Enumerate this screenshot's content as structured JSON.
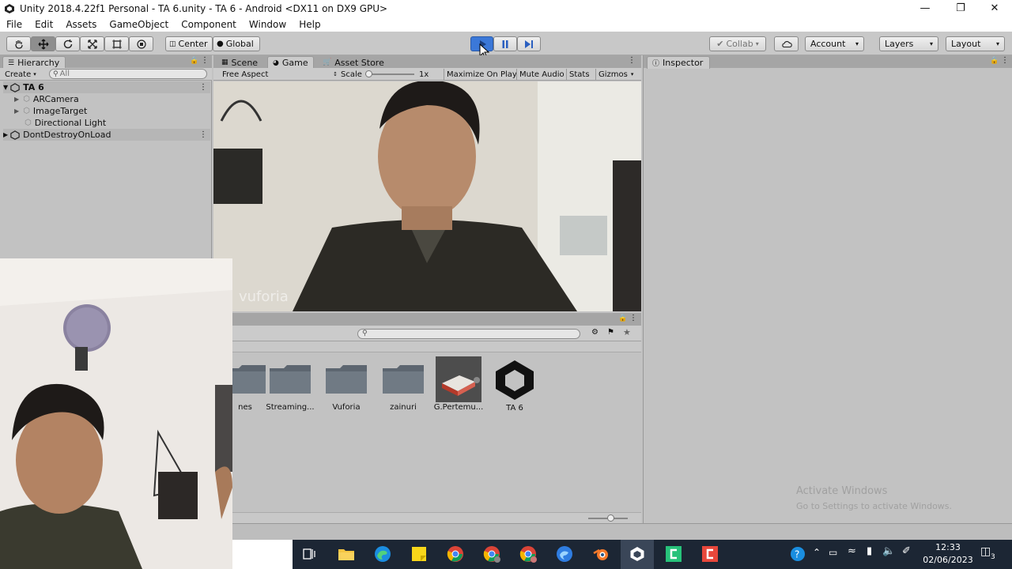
{
  "window": {
    "title": "Unity 2018.4.22f1 Personal - TA 6.unity - TA 6 - Android <DX11 on DX9 GPU>",
    "minimize_icon": "minimize-icon",
    "restore_icon": "restore-icon",
    "close_icon": "close-icon"
  },
  "menu": [
    "File",
    "Edit",
    "Assets",
    "GameObject",
    "Component",
    "Window",
    "Help"
  ],
  "toolbar": {
    "pivot_label": "Center",
    "space_label": "Global",
    "collab_label": "Collab",
    "account_label": "Account",
    "layers_label": "Layers",
    "layout_label": "Layout"
  },
  "hierarchy": {
    "tab_label": "Hierarchy",
    "create_label": "Create",
    "search_placeholder": "All",
    "scene_name": "TA 6",
    "items": [
      "ARCamera",
      "ImageTarget",
      "Directional Light"
    ],
    "dont_destroy": "DontDestroyOnLoad"
  },
  "center_tabs": {
    "scene": "Scene",
    "game": "Game",
    "asset_store": "Asset Store"
  },
  "game_toolbar": {
    "aspect": "Free Aspect",
    "scale_label": "Scale",
    "scale_value": "1x",
    "maximize": "Maximize On Play",
    "mute": "Mute Audio",
    "stats": "Stats",
    "gizmos": "Gizmos"
  },
  "game_view": {
    "watermark": "vuforia"
  },
  "project": {
    "items": [
      {
        "label": "nes",
        "kind": "folder"
      },
      {
        "label": "Streaming...",
        "kind": "folder"
      },
      {
        "label": "Vuforia",
        "kind": "folder"
      },
      {
        "label": "zainuri",
        "kind": "folder"
      },
      {
        "label": "G.Pertemu...",
        "kind": "model"
      },
      {
        "label": "TA 6",
        "kind": "unity-scene"
      }
    ]
  },
  "inspector": {
    "tab_label": "Inspector",
    "activate_line1": "Activate Windows",
    "activate_line2": "Go to Settings to activate Windows."
  },
  "taskbar": {
    "time": "12:33",
    "date": "02/06/2023",
    "notification_count": "3",
    "apps": [
      "task-view-icon",
      "file-explorer-icon",
      "edge-icon",
      "sticky-notes-icon",
      "chrome-icon",
      "chrome-icon",
      "chrome-icon",
      "edge-beta-icon",
      "blender-icon",
      "unity-icon",
      "green-app-icon",
      "red-app-icon"
    ]
  },
  "colors": {
    "play_active": "#3b78d8",
    "panel_bg": "#c2c2c2",
    "taskbar_bg": "#1c2634"
  }
}
